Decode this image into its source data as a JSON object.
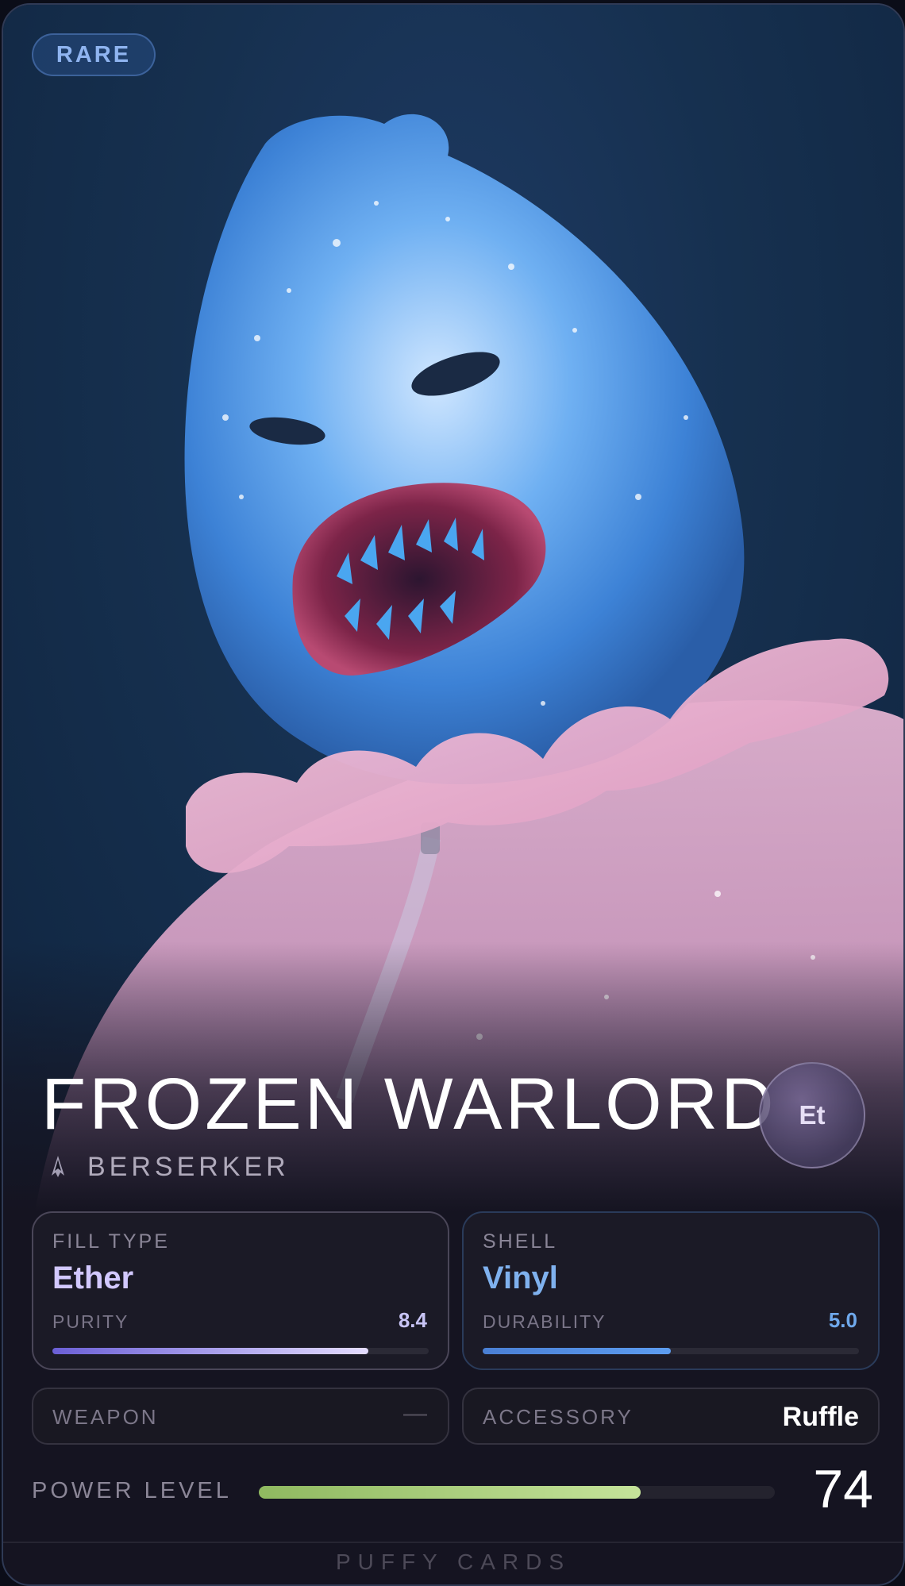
{
  "card": {
    "rarity": "RARE",
    "title": "FROZEN WARLORD",
    "class_label": "BERSERKER",
    "class_icon": "berserker-icon",
    "element_badge": "Et"
  },
  "fill": {
    "label": "FILL TYPE",
    "value": "Ether",
    "stat_name": "PURITY",
    "stat_value": "8.4",
    "stat_fraction": 0.84
  },
  "shell": {
    "label": "SHELL",
    "value": "Vinyl",
    "stat_name": "DURABILITY",
    "stat_value": "5.0",
    "stat_fraction": 0.5
  },
  "weapon": {
    "label": "WEAPON",
    "value": "—"
  },
  "accessory": {
    "label": "ACCESSORY",
    "value": "Ruffle"
  },
  "power": {
    "label": "POWER LEVEL",
    "value": "74",
    "fraction": 0.74
  },
  "footer": "PUFFY CARDS",
  "colors": {
    "rarity_accent": "#8fb4f0",
    "fill_accent": "#d2c8ff",
    "shell_accent": "#7fb1ee",
    "power_bar": "#a9cf7b"
  }
}
